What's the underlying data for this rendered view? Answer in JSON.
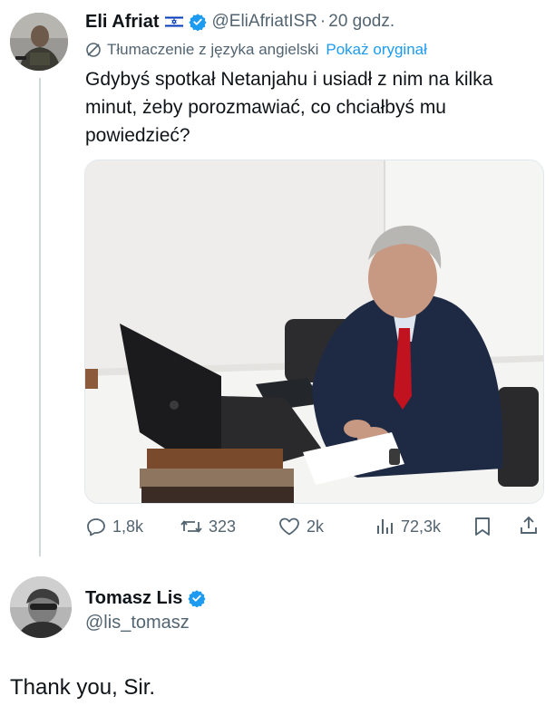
{
  "tweet": {
    "author_name": "Eli Afriat",
    "author_flag": "🇮🇱",
    "handle": "@EliAfriatISR",
    "separator": "·",
    "time": "20 godz.",
    "translation_label": "Tłumaczenie z języka angielski",
    "show_original_label": "Pokaż oryginał",
    "text": "Gdybyś spotkał Netanjahu i usiadł z nim na kilka minut, żeby porozmawiać, co chciałbyś mu powiedzieć?",
    "metrics": {
      "replies": "1,8k",
      "retweets": "323",
      "likes": "2k",
      "views": "72,3k"
    }
  },
  "reply": {
    "author_name": "Tomasz Lis",
    "handle": "@lis_tomasz",
    "text": "Thank you, Sir."
  },
  "colors": {
    "text": "#0f1419",
    "muted": "#536471",
    "accent": "#1d9bf0",
    "verified": "#1d9bf0",
    "thread_line": "#cfd9de"
  }
}
